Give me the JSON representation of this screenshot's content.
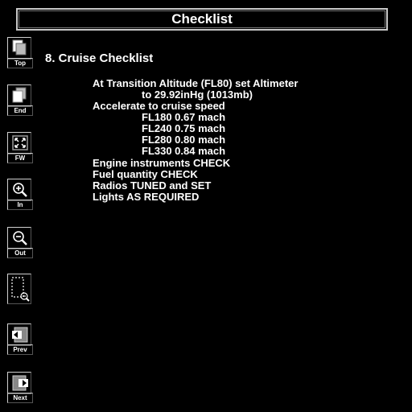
{
  "window": {
    "title": "Checklist"
  },
  "toolbar": {
    "top": "Top",
    "end": "End",
    "fw": "FW",
    "in": "In",
    "out": "Out",
    "prev": "Prev",
    "next": "Next"
  },
  "section": {
    "title": "8. Cruise Checklist"
  },
  "items": [
    "At Transition Altitude (FL80) set Altimeter",
    "to 29.92inHg (1013mb)",
    "Accelerate to cruise speed",
    "FL180 0.67 mach",
    "FL240 0.75 mach",
    "FL280 0.80 mach",
    "FL330 0.84 mach",
    "Engine instruments CHECK",
    "Fuel quantity CHECK",
    "Radios TUNED and SET",
    "Lights AS REQUIRED"
  ]
}
